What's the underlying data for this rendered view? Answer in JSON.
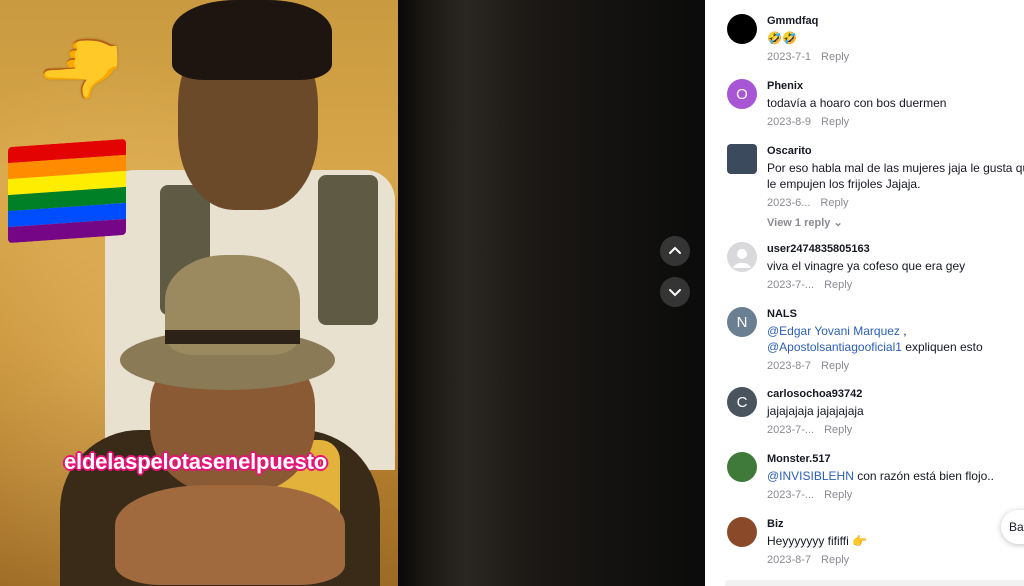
{
  "video": {
    "overlay_text": "eldelaspelotasenelpuesto",
    "emoji_pointer": "👉",
    "flag_colors": [
      "#e40303",
      "#ff8c00",
      "#ffed00",
      "#008026",
      "#004dff",
      "#750787"
    ]
  },
  "nav": {
    "up_icon": "chevron-up-icon",
    "down_icon": "chevron-down-icon"
  },
  "comments": [
    {
      "user": "Gmmdfaq",
      "text": "🤣🤣",
      "date": "2023-7-1",
      "reply": "Reply",
      "avatar_color": "#000000",
      "avatar_letter": ""
    },
    {
      "user": "Phenix",
      "text": "todavía a hoaro con bos duermen",
      "date": "2023-8-9",
      "reply": "Reply",
      "avatar_color": "#a855d6",
      "avatar_letter": "O"
    },
    {
      "user": "Oscarito",
      "text_lines": [
        "Por eso habla mal de las mujeres jaja le gusta que",
        "le empujen los frijoles Jajaja."
      ],
      "date": "2023-6...",
      "reply": "Reply",
      "view_replies": "View 1 reply",
      "avatar_color": "#3b4a5c",
      "avatar_letter": ""
    },
    {
      "user": "user2474835805163",
      "text": "viva el vinagre ya cofeso que era gey",
      "date": "2023-7-...",
      "reply": "Reply",
      "avatar_color": "#d9d9dc",
      "avatar_letter": ""
    },
    {
      "user": "NALS",
      "mention1": "@Edgar Yovani Marquez",
      "sep": " ,",
      "mention2": "@Apostolsantiagooficial1",
      "text_after": " expliquen esto",
      "date": "2023-8-7",
      "reply": "Reply",
      "avatar_color": "#6b7f93",
      "avatar_letter": "N"
    },
    {
      "user": "carlosochoa93742",
      "text": "jajajajaja jajajajaja",
      "date": "2023-7-...",
      "reply": "Reply",
      "avatar_color": "#49545e",
      "avatar_letter": "C"
    },
    {
      "user": "Monster.517",
      "mention1": "@INVISIBLEHN",
      "text_after": " con razón está bien flojo..",
      "date": "2023-7-...",
      "reply": "Reply",
      "avatar_color": "#3f7a3a",
      "avatar_letter": ""
    },
    {
      "user": "Biz",
      "text": "Heyyyyyyy fififfi 👉",
      "date": "2023-8-7",
      "reply": "Reply",
      "avatar_color": "#8a4a2a",
      "avatar_letter": ""
    }
  ],
  "back_button": "Ba"
}
